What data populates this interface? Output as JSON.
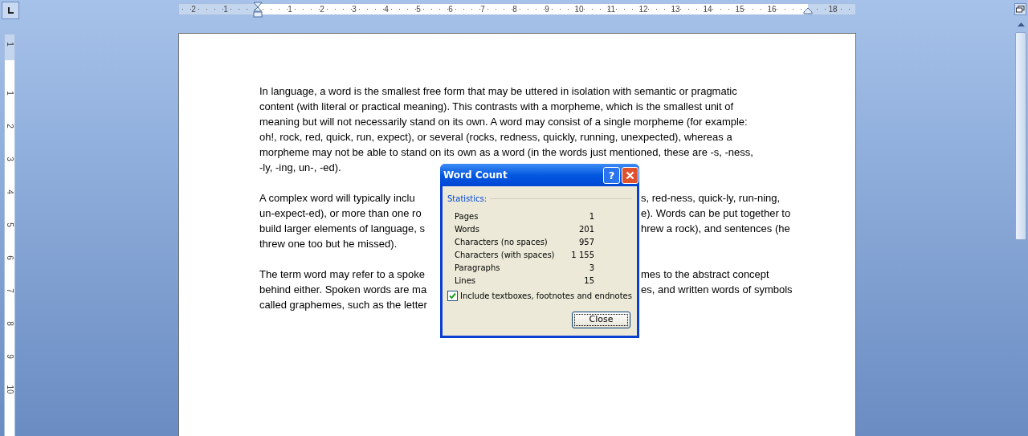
{
  "ruler": {
    "left_margin_labels": [
      "2",
      "1"
    ],
    "body_labels": [
      "1",
      "2",
      "3",
      "4",
      "5",
      "6",
      "7",
      "8",
      "9",
      "10",
      "11",
      "12",
      "13",
      "14",
      "15",
      "16"
    ],
    "right_margin_labels": [
      "18"
    ]
  },
  "vertical_ruler": {
    "top_margin_labels": [
      "1"
    ],
    "body_labels": [
      "1",
      "2",
      "3",
      "4",
      "5",
      "6",
      "7",
      "8",
      "9",
      "10"
    ]
  },
  "document": {
    "paragraphs": [
      {
        "lines": [
          {
            "left": "In language, a word is the smallest free form that may be uttered in isolation with semantic or pragmatic"
          },
          {
            "left": "content (with literal or practical meaning). This contrasts with a morpheme, which is the smallest unit of"
          },
          {
            "left": "meaning but will not necessarily stand on its own. A word may consist of a single morpheme (for example:"
          },
          {
            "left": "oh!, rock, red, quick, run, expect), or several (rocks, redness, quickly, running, unexpected), whereas a"
          },
          {
            "left": "morpheme may not be able to stand on its own as a word (in the words just mentioned, these are -s, -ness,"
          },
          {
            "left": "-ly, -ing, un-, -ed)."
          }
        ]
      },
      {
        "lines": [
          {
            "left": "A complex word will typically inclu",
            "right": "s, red-ness, quick-ly, run-ning,"
          },
          {
            "left": "un-expect-ed), or more than one ro",
            "right": "e). Words can be put together to"
          },
          {
            "left": "build larger elements of language, s",
            "right": "hrew a rock), and sentences (he"
          },
          {
            "left": "threw one too but he missed)."
          }
        ]
      },
      {
        "lines": [
          {
            "left": "The term word may refer to a spoke",
            "right": "mes to the abstract concept"
          },
          {
            "left": "behind either. Spoken words are ma",
            "right": "es, and written words of symbols"
          },
          {
            "left": "called graphemes, such as the letter"
          }
        ]
      }
    ]
  },
  "dialog": {
    "title": "Word Count",
    "help": "?",
    "section": "Statistics:",
    "stats": [
      {
        "label": "Pages",
        "value": "1"
      },
      {
        "label": "Words",
        "value": "201"
      },
      {
        "label": "Characters (no spaces)",
        "value": "957"
      },
      {
        "label": "Characters (with spaces)",
        "value": "1 155"
      },
      {
        "label": "Paragraphs",
        "value": "3"
      },
      {
        "label": "Lines",
        "value": "15"
      }
    ],
    "include": {
      "label": "Include textboxes, footnotes and endnotes",
      "checked": true
    },
    "close_button": "Close"
  }
}
